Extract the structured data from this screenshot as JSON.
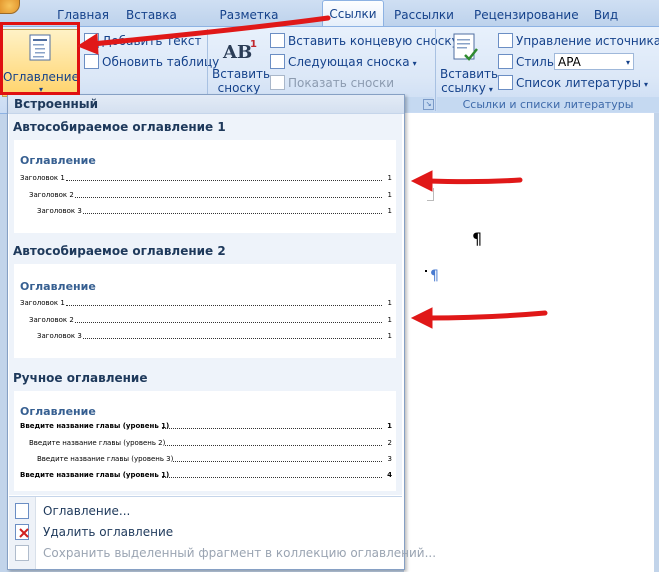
{
  "tabs": [
    {
      "label": "Главная"
    },
    {
      "label": "Вставка"
    },
    {
      "label": "Разметка страницы"
    },
    {
      "label": "Ссылки"
    },
    {
      "label": "Рассылки"
    },
    {
      "label": "Рецензирование"
    },
    {
      "label": "Вид"
    }
  ],
  "ribbon": {
    "toc_button": "Оглавление",
    "add_text": "Добавить текст",
    "update_table": "Обновить таблицу",
    "insert_footnote_line1": "Вставить",
    "insert_footnote_line2": "сноску",
    "insert_endnote": "Вставить концевую сноску",
    "next_footnote": "Следующая сноска",
    "show_notes": "Показать сноски",
    "insert_citation_line1": "Вставить",
    "insert_citation_line2": "ссылку",
    "manage_sources": "Управление источниками",
    "style_label": "Стиль:",
    "style_value": "APA",
    "bibliography": "Список литературы",
    "group_citations": "Ссылки и списки литературы"
  },
  "gallery": {
    "header": "Встроенный",
    "entries": [
      {
        "title": "Автособираемое оглавление 1",
        "toc_heading": "Оглавление",
        "lines": [
          {
            "text": "Заголовок 1",
            "page": "1"
          },
          {
            "text": "Заголовок 2",
            "page": "1"
          },
          {
            "text": "Заголовок 3",
            "page": "1"
          }
        ]
      },
      {
        "title": "Автособираемое оглавление 2",
        "toc_heading": "Оглавление",
        "lines": [
          {
            "text": "Заголовок 1",
            "page": "1"
          },
          {
            "text": "Заголовок 2",
            "page": "1"
          },
          {
            "text": "Заголовок 3",
            "page": "1"
          }
        ]
      },
      {
        "title": "Ручное оглавление",
        "toc_heading": "Оглавление",
        "lines": [
          {
            "text": "Введите название главы (уровень 1)",
            "page": "1"
          },
          {
            "text": "Введите название главы (уровень 2)",
            "page": "2"
          },
          {
            "text": "Введите название главы (уровень 3)",
            "page": "3"
          },
          {
            "text": "Введите название главы (уровень 1)",
            "page": "4"
          }
        ]
      }
    ],
    "menu": {
      "toc_dialog": "Оглавление...",
      "remove_toc": "Удалить оглавление",
      "save_selection": "Сохранить выделенный фрагмент в коллекцию оглавлений..."
    }
  },
  "document": {
    "pilcrow": "¶"
  },
  "colors": {
    "annotation": "#e01818",
    "accent": "#15428b"
  }
}
